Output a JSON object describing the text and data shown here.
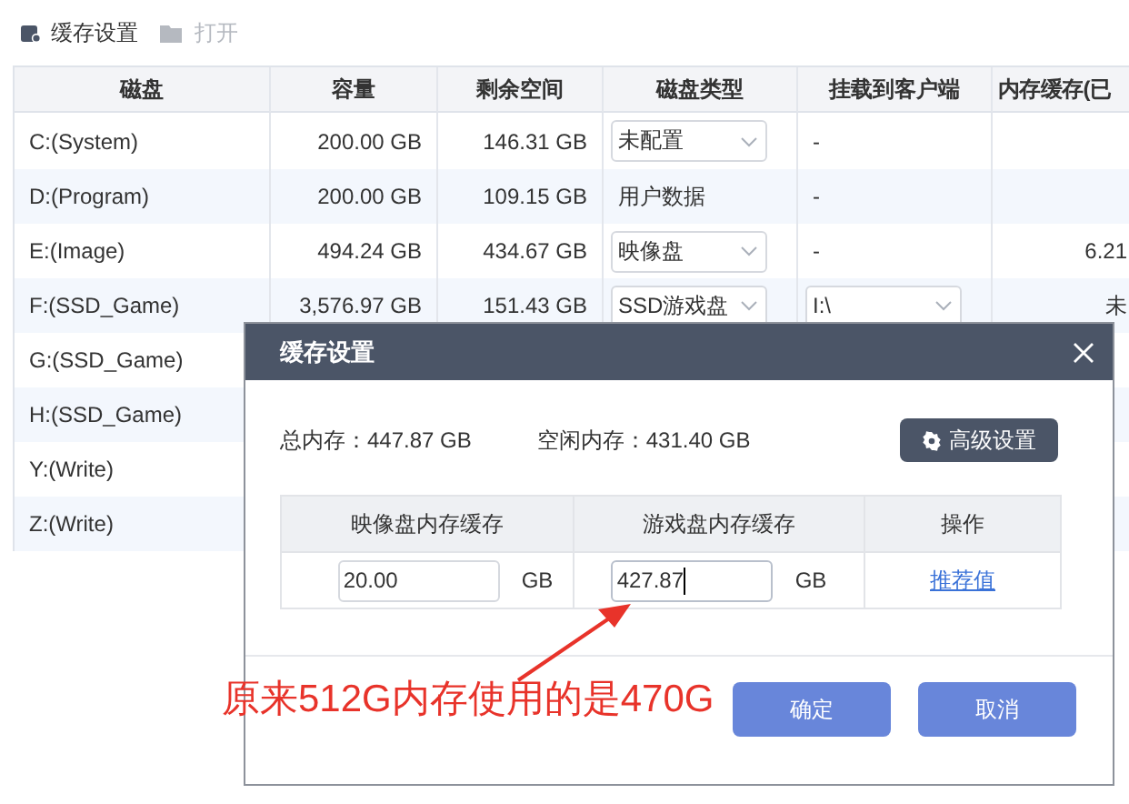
{
  "toolbar": [
    {
      "kind": "settings",
      "label": "缓存设置",
      "disabled": false
    },
    {
      "kind": "open",
      "label": "打开",
      "disabled": true
    }
  ],
  "table": {
    "columns": [
      "磁盘",
      "容量",
      "剩余空间",
      "磁盘类型",
      "挂载到客户端",
      "内存缓存(已"
    ],
    "rows": [
      {
        "disk": "C:(System)",
        "capacity": "200.00 GB",
        "free": "146.31 GB",
        "type": {
          "kind": "select",
          "value": "未配置"
        },
        "mount": {
          "kind": "text",
          "value": "-"
        }
      },
      {
        "disk": "D:(Program)",
        "capacity": "200.00 GB",
        "free": "109.15 GB",
        "type": {
          "kind": "text",
          "value": "用户数据"
        },
        "mount": {
          "kind": "text",
          "value": "-"
        }
      },
      {
        "disk": "E:(Image)",
        "capacity": "494.24 GB",
        "free": "434.67 GB",
        "type": {
          "kind": "select",
          "value": "映像盘"
        },
        "mount": {
          "kind": "text",
          "value": "-"
        },
        "cache": "6.21"
      },
      {
        "disk": "F:(SSD_Game)",
        "capacity": "3,576.97 GB",
        "free": "151.43 GB",
        "type": {
          "kind": "select",
          "value": "SSD游戏盘"
        },
        "mount": {
          "kind": "select",
          "value": "I:\\"
        },
        "cache": "未"
      },
      {
        "disk": "G:(SSD_Game)"
      },
      {
        "disk": "H:(SSD_Game)"
      },
      {
        "disk": "Y:(Write)"
      },
      {
        "disk": "Z:(Write)"
      }
    ]
  },
  "dialog": {
    "title": "缓存设置",
    "total_memory": "总内存：447.87 GB",
    "free_memory": "空闲内存：431.40 GB",
    "advanced_button": "高级设置",
    "columns": [
      "映像盘内存缓存",
      "游戏盘内存缓存",
      "操作"
    ],
    "image_cache": {
      "value": "20.00",
      "unit": "GB",
      "focused": false
    },
    "game_cache": {
      "value": "427.87",
      "unit": "GB",
      "focused": true
    },
    "action_link": "推荐值",
    "buttons": [
      "确定",
      "取消"
    ]
  },
  "annotation": {
    "text": "原来512G内存使用的是470G"
  }
}
